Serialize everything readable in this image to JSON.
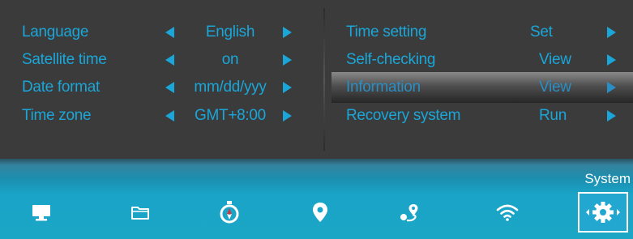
{
  "left_settings": [
    {
      "label": "Language",
      "value": "English"
    },
    {
      "label": "Satellite time",
      "value": "on"
    },
    {
      "label": "Date format",
      "value": "mm/dd/yyy"
    },
    {
      "label": "Time zone",
      "value": "GMT+8:00"
    }
  ],
  "right_settings": [
    {
      "label": "Time setting",
      "value": "Set"
    },
    {
      "label": "Self-checking",
      "value": "View"
    },
    {
      "label": "Information",
      "value": "View",
      "selected": true
    },
    {
      "label": "Recovery system",
      "value": "Run"
    }
  ],
  "bottom_nav": {
    "active_tab_label": "System",
    "items": [
      {
        "icon": "monitor-icon"
      },
      {
        "icon": "folder-icon"
      },
      {
        "icon": "compass-icon"
      },
      {
        "icon": "location-pin-icon"
      },
      {
        "icon": "route-icon"
      },
      {
        "icon": "wifi-icon"
      },
      {
        "icon": "gear-icon",
        "active": true
      }
    ]
  },
  "colors": {
    "accent": "#1aa6d8",
    "background": "#3b3b3b",
    "nav_bar": "#1aa4c8",
    "icon_white": "#ffffff",
    "compass_red": "#d8323a"
  }
}
